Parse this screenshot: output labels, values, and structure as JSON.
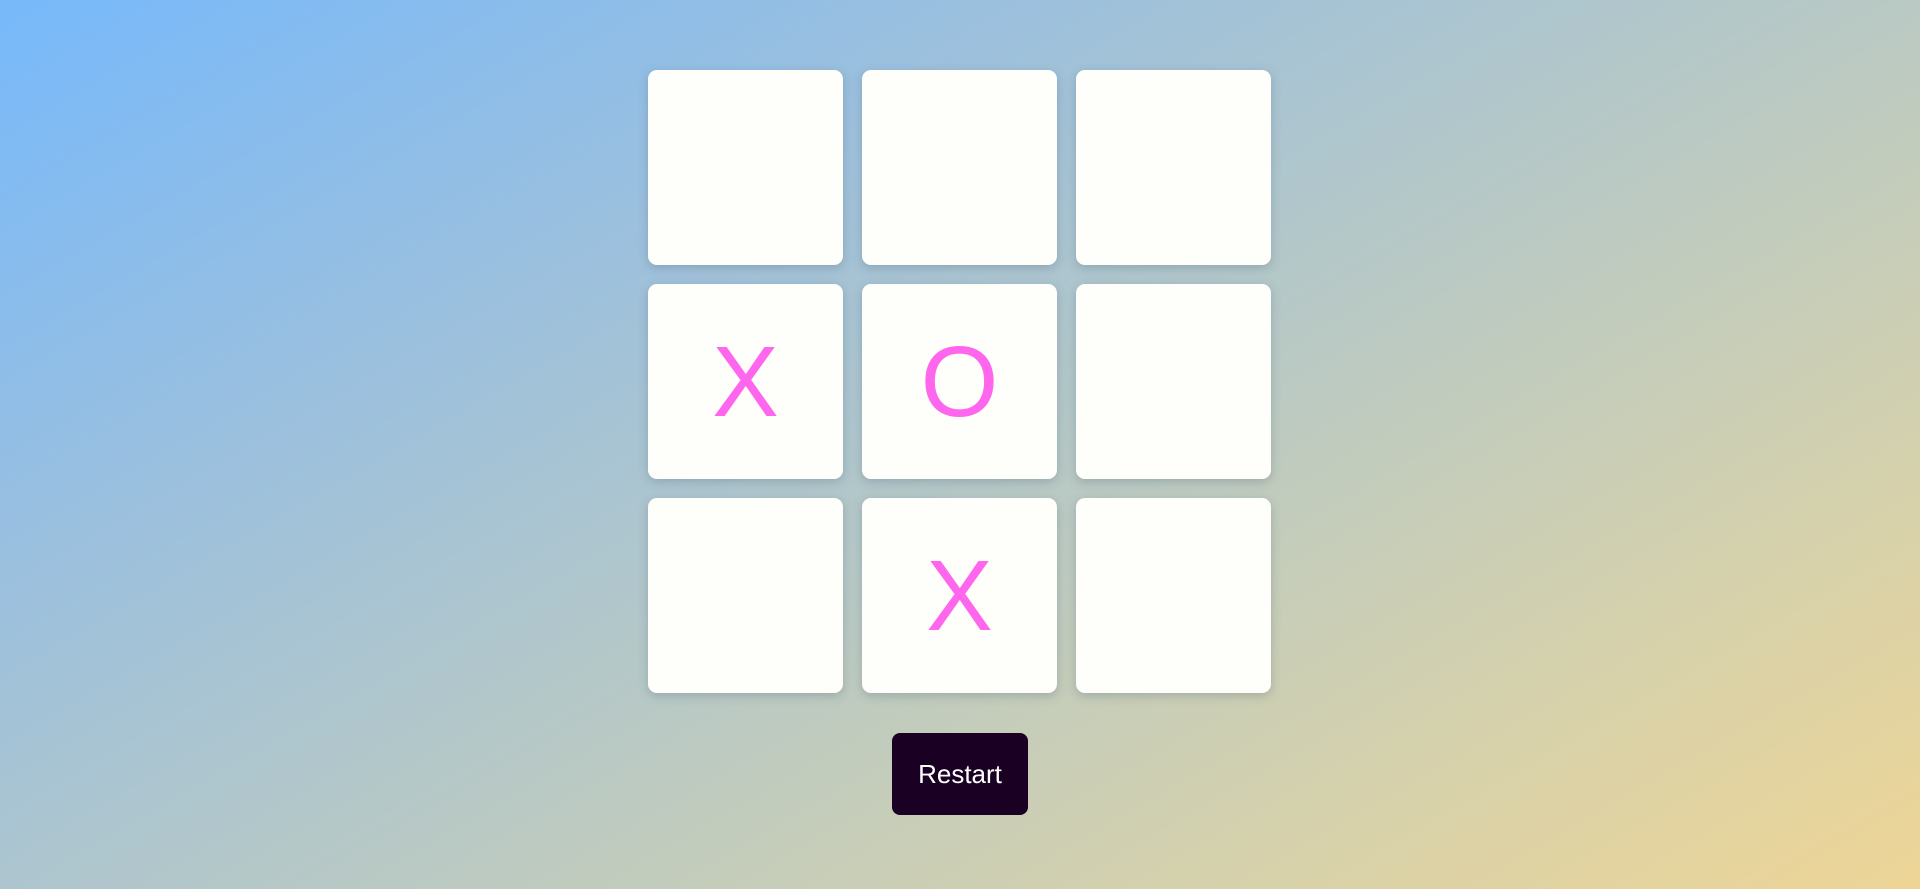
{
  "game": {
    "board": [
      {
        "position": 1,
        "value": ""
      },
      {
        "position": 2,
        "value": ""
      },
      {
        "position": 3,
        "value": ""
      },
      {
        "position": 4,
        "value": "X"
      },
      {
        "position": 5,
        "value": "O"
      },
      {
        "position": 6,
        "value": ""
      },
      {
        "position": 7,
        "value": ""
      },
      {
        "position": 8,
        "value": "X"
      },
      {
        "position": 9,
        "value": ""
      }
    ],
    "restart_label": "Restart"
  },
  "colors": {
    "mark": "#ff66ee",
    "cell_background": "#fefefa",
    "button_background": "#1a0023",
    "button_text": "#ffffff",
    "background_start": "#77b9fb",
    "background_end": "#eed596"
  }
}
